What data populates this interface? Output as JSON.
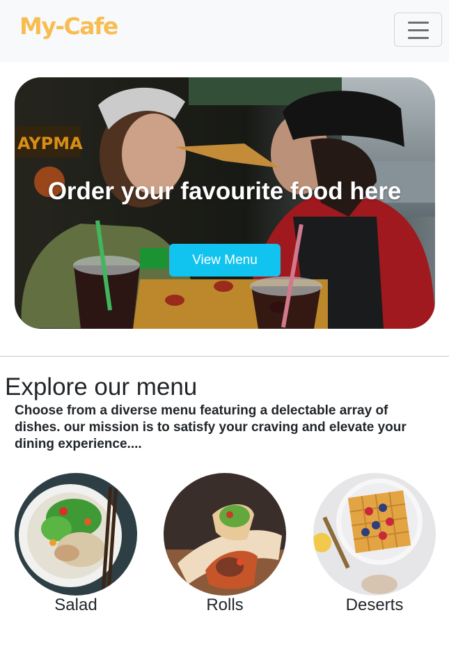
{
  "navbar": {
    "brand": "My-Cafe",
    "toggle_icon": "hamburger-menu-icon"
  },
  "hero": {
    "image": "couple-eating-pizza-photo",
    "title": "Order your favourite food here",
    "button_label": "View Menu",
    "sign_text": "AYPMA"
  },
  "explore": {
    "title": "Explore our menu",
    "description": "Choose from a diverse menu featuring a delectable array of dishes. our mission is to satisfy your craving and elevate your dining experience....",
    "categories": [
      {
        "label": "Salad",
        "image": "salad-bowl-photo"
      },
      {
        "label": "Rolls",
        "image": "wrap-rolls-photo"
      },
      {
        "label": "Deserts",
        "image": "waffle-berries-photo"
      }
    ]
  },
  "colors": {
    "brand": "#f7bd52",
    "button": "#11c3ef",
    "navbar_bg": "#f8f9fa"
  }
}
